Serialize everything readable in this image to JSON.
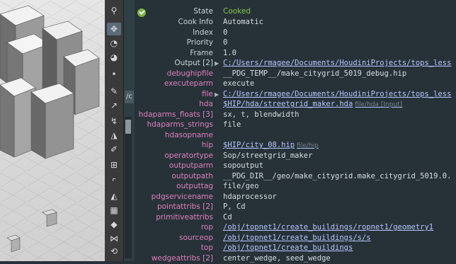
{
  "status": {
    "label": "State",
    "value": "Cooked"
  },
  "rows": [
    {
      "key": "Cook Info",
      "val": "Automatic"
    },
    {
      "key": "Index",
      "val": "0"
    },
    {
      "key": "Priority",
      "val": "0"
    },
    {
      "key": "Frame",
      "val": "1.0"
    },
    {
      "key": "Output [2]",
      "val": "C:/Users/rmagee/Documents/HoudiniProjects/tops_less"
    },
    {
      "key": "debughipfile",
      "val": "__PDG_TEMP__/make_citygrid_5019_debug.hip"
    },
    {
      "key": "executeparm",
      "val": "execute"
    },
    {
      "key": "file",
      "val": "C:/Users/rmagee/Documents/HoudiniProjects/tops_less"
    },
    {
      "key": "hda",
      "val": "$HIP/hda/streetgrid_maker.hda",
      "hint": "file/hda [Input]"
    },
    {
      "key": "hdaparms_floats [3]",
      "val": "sx, t, blendwidth"
    },
    {
      "key": "hdaparms_strings",
      "val": "file"
    },
    {
      "key": "hdasopname",
      "val": ""
    },
    {
      "key": "hip",
      "val": "$HIP/city_08.hip",
      "hint": "file/hip"
    },
    {
      "key": "operatortype",
      "val": "Sop/streetgrid_maker"
    },
    {
      "key": "outputparm",
      "val": "sopoutput"
    },
    {
      "key": "outputpath",
      "val": "__PDG_DIR__/geo/make_citygrid.make_citygrid_5019.0."
    },
    {
      "key": "outputtag",
      "val": "file/geo"
    },
    {
      "key": "pdgservicename",
      "val": "hdaprocessor"
    },
    {
      "key": "pointattribs [2]",
      "val": "P, Cd"
    },
    {
      "key": "primitiveattribs",
      "val": "Cd"
    },
    {
      "key": "rop",
      "val": "/obj/topnet1/create_buildings/ropnet1/geometry1"
    },
    {
      "key": "sourceop",
      "val": "/obj/topnet1/create_buildings/s/s"
    },
    {
      "key": "top",
      "val": "/obj/topnet1/create_buildings"
    },
    {
      "key": "wedgeattribs [2]",
      "val": "center_wedge, seed_wedge"
    }
  ],
  "tab_stub": "/c",
  "colors": {
    "key_pink": "#e07fc0",
    "key_white": "#c9d2d6",
    "status_green": "#8bc34a",
    "link": "#b8c6ff",
    "panel_bg": "#263238"
  }
}
